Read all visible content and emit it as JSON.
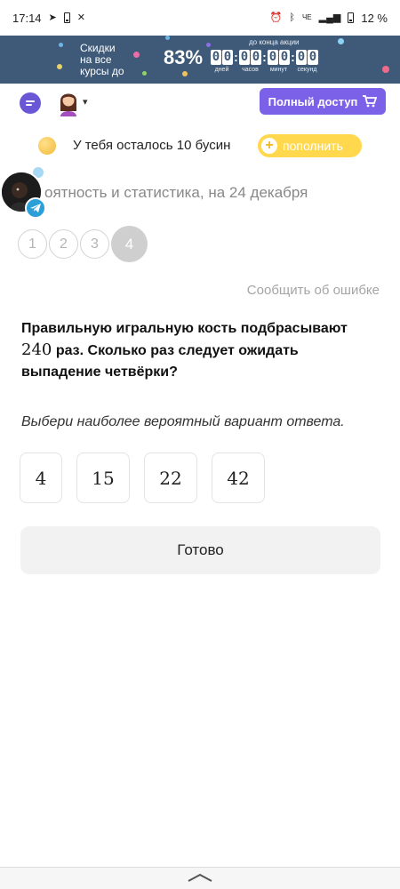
{
  "status_bar": {
    "time": "17:14",
    "left_icons": [
      "telegram-icon",
      "battery-saver-icon",
      "app-icon"
    ],
    "right_icons": [
      "alarm-icon",
      "bluetooth-icon",
      "signal-icon"
    ],
    "network": "ЧЕ",
    "battery": "12 %"
  },
  "promo": {
    "line1": "Скидки",
    "line2": "на все",
    "line3": "курсы до",
    "percent": "83%",
    "until_label": "до конца акции",
    "timer": [
      {
        "d1": "0",
        "d2": "0",
        "label": "дней"
      },
      {
        "d1": "0",
        "d2": "0",
        "label": "часов"
      },
      {
        "d1": "0",
        "d2": "0",
        "label": "минут"
      },
      {
        "d1": "0",
        "d2": "0",
        "label": "секунд"
      }
    ]
  },
  "nav": {
    "full_access_label": "Полный доступ"
  },
  "beads": {
    "text": "У тебя осталось 10 бусин",
    "topup_label": "пополнить"
  },
  "topic": {
    "title": "оятность и статистика, на 24 декабря"
  },
  "steps": [
    "1",
    "2",
    "3",
    "4"
  ],
  "active_step": "4",
  "report_link": "Сообщить об ошибке",
  "question": {
    "part1": "Правильную игральную кость подбрасывают",
    "number": "240",
    "part2": "раз. Сколько раз следует ожидать выпадение четвёрки?"
  },
  "instruction": "Выбери наиболее вероятный вариант ответа.",
  "options": [
    "4",
    "15",
    "22",
    "42"
  ],
  "done_label": "Готово",
  "colors": {
    "promo_bg": "#3e5a78",
    "accent_purple": "#7b61e8",
    "topup_yellow": "#ffd84d",
    "telegram_blue": "#2a9fd8"
  }
}
